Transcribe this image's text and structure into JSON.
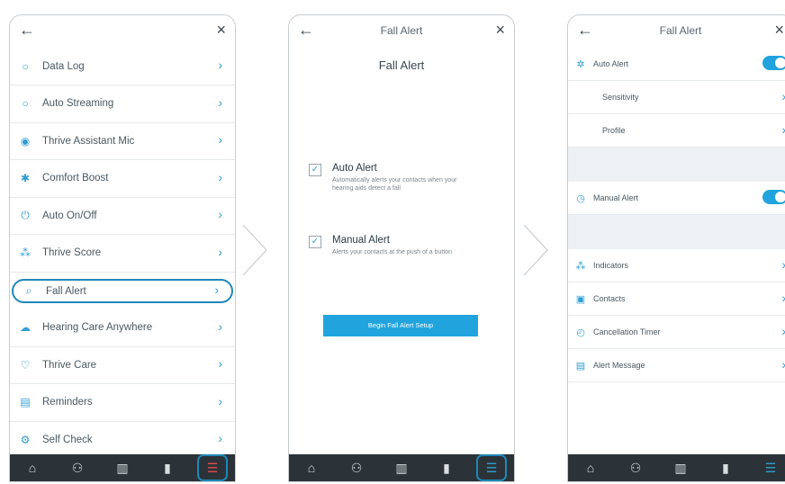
{
  "icons": {
    "back": "←",
    "close": "×",
    "chevron": "›",
    "check": "✓"
  },
  "screen1": {
    "items": [
      {
        "label": "Data Log",
        "icon": "○"
      },
      {
        "label": "Auto Streaming",
        "icon": "○"
      },
      {
        "label": "Thrive Assistant Mic",
        "icon": "◉"
      },
      {
        "label": "Comfort Boost",
        "icon": "✱"
      },
      {
        "label": "Auto On/Off",
        "icon": "⏻"
      },
      {
        "label": "Thrive Score",
        "icon": "⁂"
      },
      {
        "label": "Fall Alert",
        "icon": "⌕"
      },
      {
        "label": "Hearing Care Anywhere",
        "icon": "☁"
      },
      {
        "label": "Thrive Care",
        "icon": "♡"
      },
      {
        "label": "Reminders",
        "icon": "▤"
      },
      {
        "label": "Self Check",
        "icon": "⚙"
      }
    ]
  },
  "screen2": {
    "title": "Fall Alert",
    "heading": "Fall Alert",
    "auto_title": "Auto Alert",
    "auto_desc": "Automatically alerts your contacts when your hearing aids detect a fall",
    "manual_title": "Manual Alert",
    "manual_desc": "Alerts your contacts at the push of a button",
    "button": "Begin Fall Alert Setup"
  },
  "screen3": {
    "title": "Fall Alert",
    "auto_alert": "Auto Alert",
    "sensitivity": "Sensitivity",
    "profile": "Profile",
    "manual_alert": "Manual Alert",
    "indicators": "Indicators",
    "contacts": "Contacts",
    "cancellation_timer": "Cancellation Timer",
    "alert_message": "Alert Message"
  },
  "nav": [
    "⌂",
    "⚇",
    "▥",
    "▮",
    "☰"
  ],
  "colors": {
    "accent": "#21a4dd",
    "navbar": "#2b3338"
  }
}
